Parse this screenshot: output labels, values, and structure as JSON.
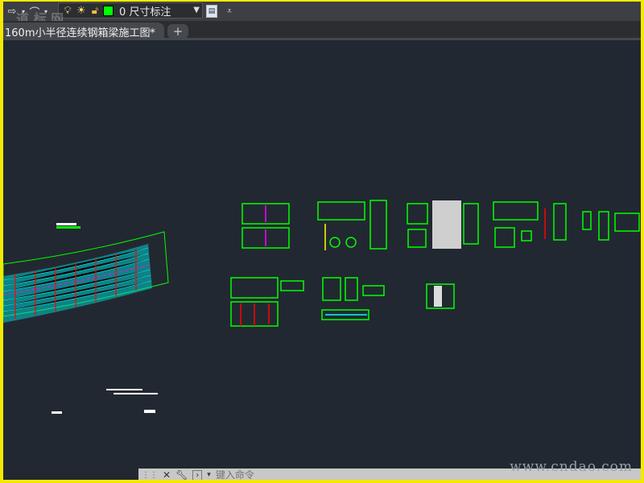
{
  "toolbar": {
    "layer_name": "0 尺寸标注",
    "layer_color": "#00ff00",
    "icons": [
      "redo-icon",
      "polyline-icon",
      "lightbulb-icon",
      "sun-icon",
      "unlock-icon",
      "layer-color-swatch",
      "layer-properties-icon",
      "overflow-menu-icon"
    ]
  },
  "tabs": {
    "active_title": "160m小半径连续钢箱梁施工图*",
    "close": "×",
    "add": "+"
  },
  "command_line": {
    "placeholder": "键入命令"
  },
  "watermark": {
    "url": "www.cndao.com",
    "logo": "道 标 网"
  },
  "colors": {
    "canvas": "#222831",
    "green": "#00ff00",
    "cyan": "#00ffff",
    "red": "#ff0000",
    "magenta": "#ff00ff",
    "border": "#f5e900"
  }
}
